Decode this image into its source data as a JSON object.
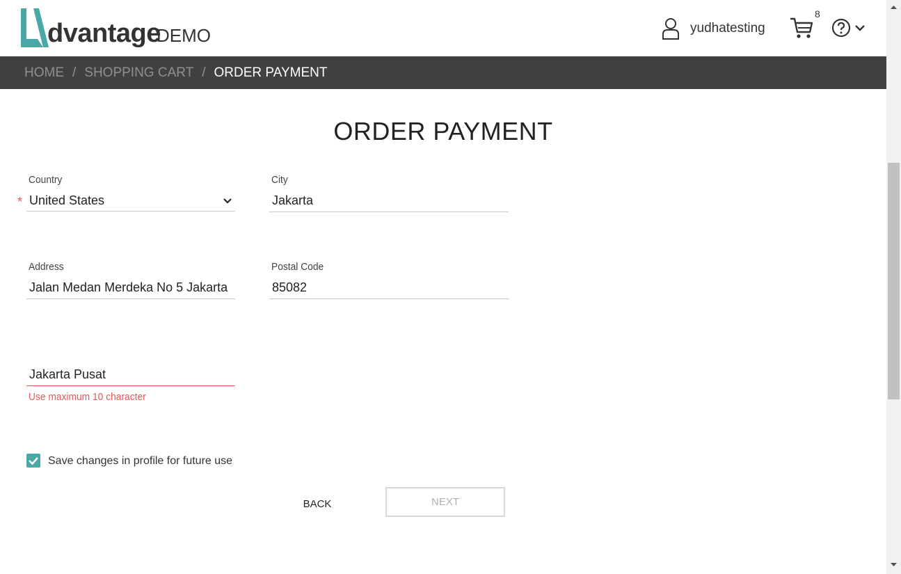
{
  "header": {
    "logo_word": "dvantage",
    "logo_demo": "DEMO",
    "username": "yudhatesting",
    "cart_count": "8",
    "brand_color": "#4aa9a7"
  },
  "breadcrumb": {
    "home": "HOME",
    "separator": "/",
    "shopping_cart": "SHOPPING CART",
    "current": "ORDER PAYMENT"
  },
  "main": {
    "title": "ORDER PAYMENT",
    "fields": {
      "country": {
        "label": "Country",
        "value": "United States",
        "required_mark": "*"
      },
      "city": {
        "label": "City",
        "value": "Jakarta"
      },
      "address": {
        "label": "Address",
        "value": "Jalan Medan Merdeka No 5 Jakarta"
      },
      "postal_code": {
        "label": "Postal Code",
        "value": "85082"
      },
      "state": {
        "label": "",
        "value": "Jakarta Pusat",
        "error": "Use maximum 10 character"
      }
    },
    "save_profile": {
      "label": "Save changes in profile for future use",
      "checked": true
    },
    "buttons": {
      "back": "BACK",
      "next": "NEXT"
    }
  },
  "colors": {
    "accent": "#4aa9a7",
    "error": "#e05a5a",
    "breadcrumb_bg": "#414141"
  }
}
